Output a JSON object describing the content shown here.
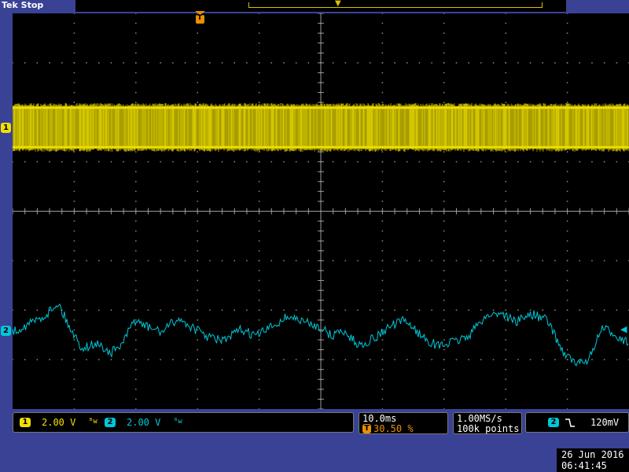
{
  "header": {
    "brand": "Tek",
    "run_state": "Stop"
  },
  "colors": {
    "ch1": "#f0e000",
    "ch2": "#00c8d8",
    "background": "#3a4296",
    "screen": "#000000"
  },
  "markers": {
    "trigger_position": "T",
    "ch1_ground": "1",
    "ch2_ground": "2"
  },
  "channels": [
    {
      "id": "1",
      "scale": "2.00 V",
      "bandwidth_icon": "bandwidth-limit-icon"
    },
    {
      "id": "2",
      "scale": "2.00 V",
      "bandwidth_icon": "bandwidth-limit-icon"
    }
  ],
  "horizontal": {
    "timebase": "10.0ms",
    "trigger_marker": "T",
    "trigger_position": "30.50 %"
  },
  "acquisition": {
    "sample_rate": "1.00MS/s",
    "record_length": "100k points"
  },
  "trigger": {
    "source": "2",
    "slope_icon": "falling-edge-icon",
    "level": "120mV"
  },
  "datetime": {
    "date": "26 Jun  2016",
    "time": "06:41:45"
  }
}
